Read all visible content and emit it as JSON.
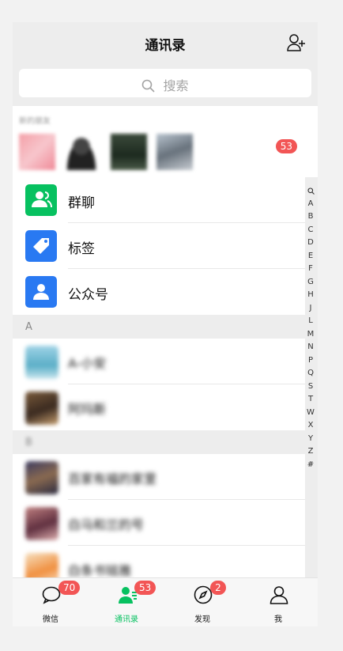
{
  "header": {
    "title": "通讯录"
  },
  "search": {
    "placeholder": "搜索"
  },
  "new_friends": {
    "label": "新的朋友",
    "badge": "53"
  },
  "features": [
    {
      "label": "群聊",
      "color": "#07c160",
      "icon": "group-icon"
    },
    {
      "label": "标签",
      "color": "#2979f2",
      "icon": "tag-icon"
    },
    {
      "label": "公众号",
      "color": "#2979f2",
      "icon": "official-account-icon"
    }
  ],
  "sections": [
    {
      "letter": "A",
      "contacts": [
        {
          "name": "A-小安"
        },
        {
          "name": "阿玛斯"
        }
      ]
    },
    {
      "letter": "B",
      "contacts": [
        {
          "name": "百家有福的家里"
        },
        {
          "name": "白马和兰的号"
        },
        {
          "name": "白条书铭雅"
        }
      ]
    }
  ],
  "alphabet_index": [
    "A",
    "B",
    "C",
    "D",
    "E",
    "F",
    "G",
    "H",
    "J",
    "L",
    "M",
    "N",
    "P",
    "Q",
    "S",
    "T",
    "W",
    "X",
    "Y",
    "Z",
    "#"
  ],
  "tabs": [
    {
      "label": "微信",
      "badge": "70",
      "active": false
    },
    {
      "label": "通讯录",
      "badge": "53",
      "active": true
    },
    {
      "label": "发现",
      "badge": "2",
      "active": false
    },
    {
      "label": "我",
      "badge": "",
      "active": false
    }
  ],
  "colors": {
    "accent": "#07c160",
    "badge": "#f25555",
    "blue": "#2979f2"
  }
}
